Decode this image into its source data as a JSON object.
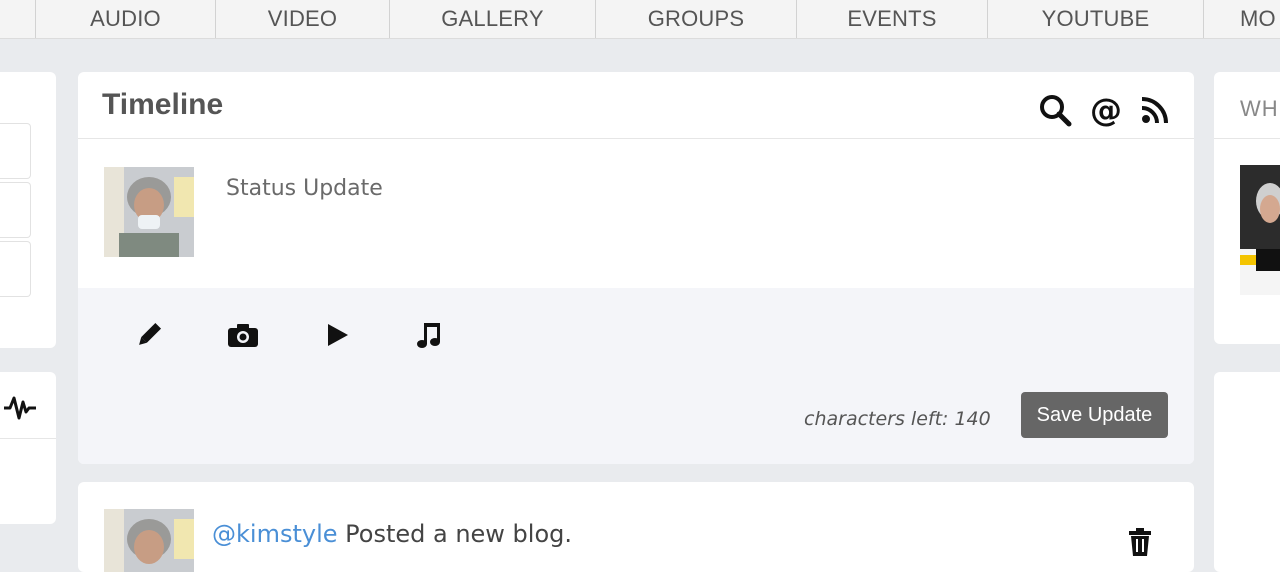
{
  "nav": {
    "items": [
      "AUDIO",
      "VIDEO",
      "GALLERY",
      "GROUPS",
      "EVENTS",
      "YOUTUBE",
      "MO"
    ]
  },
  "timeline": {
    "title": "Timeline",
    "icons": [
      "search-icon",
      "at-icon",
      "rss-icon"
    ],
    "composer": {
      "placeholder": "Status Update",
      "tools": [
        "pencil-icon",
        "camera-icon",
        "play-icon",
        "music-note-icon"
      ],
      "chars_left_label": "characters left: 140",
      "save_label": "Save Update"
    }
  },
  "post": {
    "username": "@kimstyle",
    "action": "Posted a new blog."
  },
  "right": {
    "heading": "WH"
  },
  "colors": {
    "background": "#e9ebee",
    "panel": "#ffffff",
    "toolbar": "#f4f5f9",
    "button": "#666666",
    "link": "#4a8fd6"
  }
}
